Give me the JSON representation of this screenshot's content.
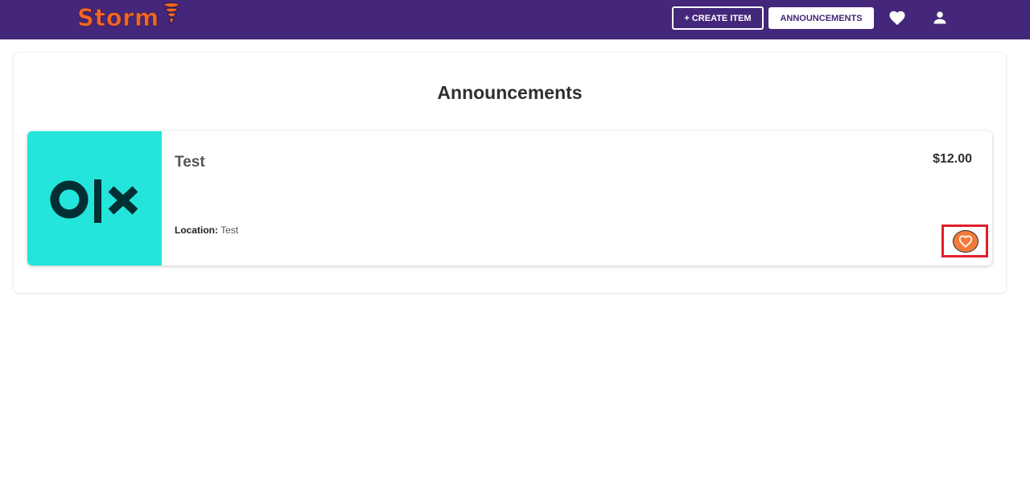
{
  "header": {
    "logo_text": "Storm",
    "create_label": "+ CREATE ITEM",
    "announcements_label": "ANNOUNCEMENTS",
    "favorites_icon": "heart-icon",
    "profile_icon": "user-icon",
    "background_color": "#44277a",
    "logo_color": "#f26522"
  },
  "main": {
    "title": "Announcements",
    "announcements": [
      {
        "image_alt_logo": "olx",
        "image_background": "#23e5db",
        "title": "Test",
        "price": "$12.00",
        "location_label": "Location:",
        "location_value": "Test",
        "favorite_icon": "heart-outline-icon",
        "favorite_color": "#f57a3a"
      }
    ]
  }
}
